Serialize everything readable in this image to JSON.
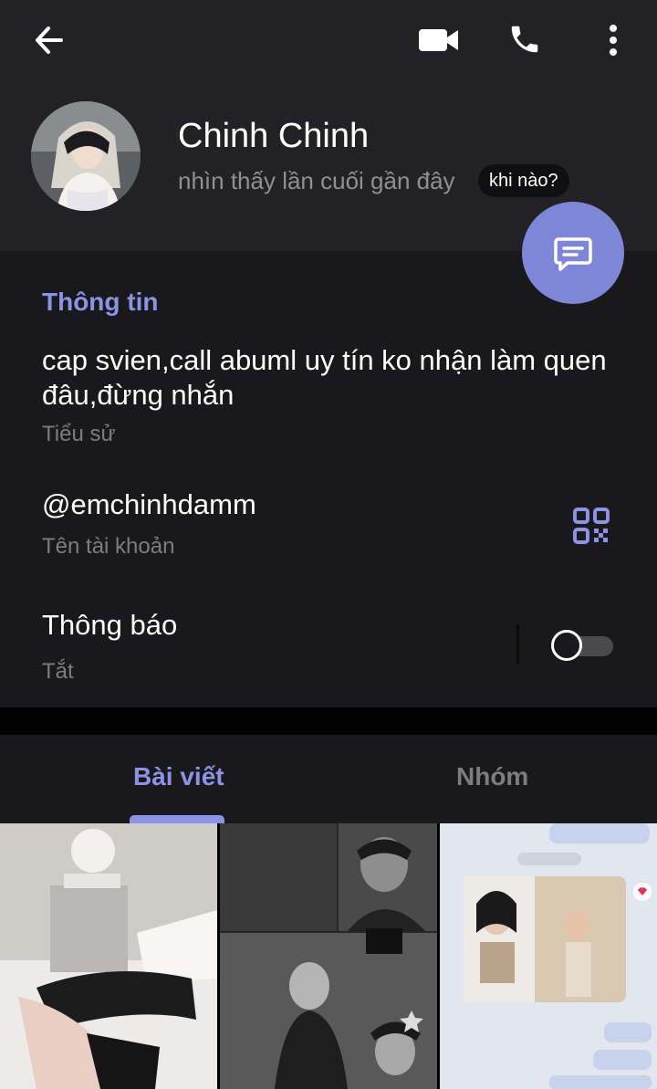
{
  "profile": {
    "name": "Chinh Chinh",
    "last_seen": "nhìn thấy lần cuối gần đây",
    "when_chip": "khi nào?"
  },
  "icons": {
    "back": "arrow-left-icon",
    "video": "video-camera-icon",
    "phone": "phone-icon",
    "more": "more-vertical-icon",
    "message": "message-icon",
    "qr": "qr-code-icon"
  },
  "info": {
    "section_title": "Thông tin",
    "bio": "cap svien,call abuml uy tín ko nhận làm quen đâu,đừng nhắn",
    "bio_label": "Tiểu sử",
    "username": "@emchinhdamm",
    "username_label": "Tên tài khoản",
    "notifications_title": "Thông báo",
    "notifications_status": "Tắt",
    "notifications_enabled": false
  },
  "tabs": [
    {
      "label": "Bài viết",
      "active": true
    },
    {
      "label": "Nhóm",
      "active": false
    }
  ],
  "colors": {
    "accent": "#8b93e6",
    "fab": "#7e86d8",
    "header_bg": "#222224",
    "panel_bg": "#19191b"
  }
}
